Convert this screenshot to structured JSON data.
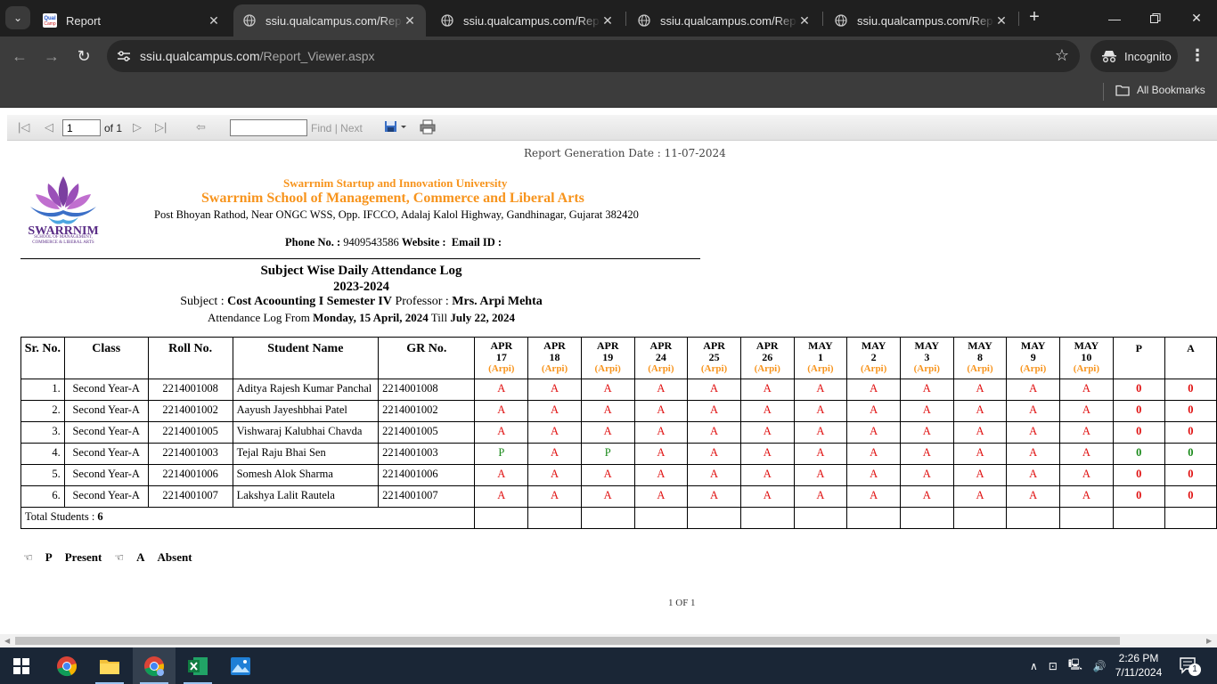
{
  "browser": {
    "tabs": [
      {
        "title": "Report",
        "active": false
      },
      {
        "title": "ssiu.qualcampus.com/Report_Viewer.aspx",
        "active": true
      },
      {
        "title": "ssiu.qualcampus.com/Report_Viewer.aspx",
        "active": false
      },
      {
        "title": "ssiu.qualcampus.com/Report_Viewer.aspx",
        "active": false
      },
      {
        "title": "ssiu.qualcampus.com/Report_Viewer.aspx",
        "active": false
      }
    ],
    "url_host": "ssiu.qualcampus.com",
    "url_path": "/Report_Viewer.aspx",
    "incognito_label": "Incognito",
    "bookmarks_label": "All Bookmarks"
  },
  "viewer": {
    "page_value": "1",
    "of_label": "of 1",
    "find_label": "Find",
    "separator": "|",
    "next_label": "Next"
  },
  "report": {
    "generation_date": "Report Generation Date : 11-07-2024",
    "logo_text": "SWARRNIM",
    "logo_subtext": "SCHOOL OF MANAGEMENT, COMMERCE & LIBERAL ARTS",
    "university": "Swarrnim Startup and Innovation University",
    "school": "Swarrnim School of Management, Commerce and Liberal Arts",
    "address": "Post Bhoyan Rathod, Near ONGC WSS, Opp. IFCCO, Adalaj Kalol Highway, Gandhinagar, Gujarat 382420",
    "phone_label": "Phone No. :",
    "phone": "9409543586",
    "website_label": "Website :",
    "email_label": "Email ID :",
    "title": "Subject Wise Daily Attendance Log",
    "year": "2023-2024",
    "subject_label": "Subject :",
    "subject": "Cost Acoounting I Semester IV",
    "professor_label": "Professor :",
    "professor": "Mrs. Arpi Mehta",
    "log_from_label": "Attendance Log From",
    "log_from": "Monday, 15 April, 2024",
    "till_label": "Till",
    "log_till": "July 22, 2024",
    "headers": [
      "Sr. No.",
      "Class",
      "Roll No.",
      "Student Name",
      "GR No."
    ],
    "dates": [
      {
        "m": "APR",
        "d": "17",
        "p": "(Arpi)"
      },
      {
        "m": "APR",
        "d": "18",
        "p": "(Arpi)"
      },
      {
        "m": "APR",
        "d": "19",
        "p": "(Arpi)"
      },
      {
        "m": "APR",
        "d": "24",
        "p": "(Arpi)"
      },
      {
        "m": "APR",
        "d": "25",
        "p": "(Arpi)"
      },
      {
        "m": "APR",
        "d": "26",
        "p": "(Arpi)"
      },
      {
        "m": "MAY",
        "d": "1",
        "p": "(Arpi)"
      },
      {
        "m": "MAY",
        "d": "2",
        "p": "(Arpi)"
      },
      {
        "m": "MAY",
        "d": "3",
        "p": "(Arpi)"
      },
      {
        "m": "MAY",
        "d": "8",
        "p": "(Arpi)"
      },
      {
        "m": "MAY",
        "d": "9",
        "p": "(Arpi)"
      },
      {
        "m": "MAY",
        "d": "10",
        "p": "(Arpi)"
      }
    ],
    "p_header": "P",
    "a_header": "A",
    "rows": [
      {
        "sr": "1.",
        "cls": "Second Year-A",
        "roll": "2214001008",
        "name": "Aditya Rajesh Kumar Panchal",
        "gr": "2214001008",
        "marks": [
          "A",
          "A",
          "A",
          "A",
          "A",
          "A",
          "A",
          "A",
          "A",
          "A",
          "A",
          "A"
        ],
        "p": "0",
        "a": "0"
      },
      {
        "sr": "2.",
        "cls": "Second Year-A",
        "roll": "2214001002",
        "name": "Aayush Jayeshbhai Patel",
        "gr": "2214001002",
        "marks": [
          "A",
          "A",
          "A",
          "A",
          "A",
          "A",
          "A",
          "A",
          "A",
          "A",
          "A",
          "A"
        ],
        "p": "0",
        "a": "0"
      },
      {
        "sr": "3.",
        "cls": "Second Year-A",
        "roll": "2214001005",
        "name": "Vishwaraj Kalubhai Chavda",
        "gr": "2214001005",
        "marks": [
          "A",
          "A",
          "A",
          "A",
          "A",
          "A",
          "A",
          "A",
          "A",
          "A",
          "A",
          "A"
        ],
        "p": "0",
        "a": "0"
      },
      {
        "sr": "4.",
        "cls": "Second Year-A",
        "roll": "2214001003",
        "name": "Tejal Raju Bhai Sen",
        "gr": "2214001003",
        "marks": [
          "P",
          "A",
          "P",
          "A",
          "A",
          "A",
          "A",
          "A",
          "A",
          "A",
          "A",
          "A"
        ],
        "p": "0",
        "a": "0"
      },
      {
        "sr": "5.",
        "cls": "Second Year-A",
        "roll": "2214001006",
        "name": "Somesh Alok Sharma",
        "gr": "2214001006",
        "marks": [
          "A",
          "A",
          "A",
          "A",
          "A",
          "A",
          "A",
          "A",
          "A",
          "A",
          "A",
          "A"
        ],
        "p": "0",
        "a": "0"
      },
      {
        "sr": "6.",
        "cls": "Second Year-A",
        "roll": "2214001007",
        "name": "Lakshya Lalit Rautela",
        "gr": "2214001007",
        "marks": [
          "A",
          "A",
          "A",
          "A",
          "A",
          "A",
          "A",
          "A",
          "A",
          "A",
          "A",
          "A"
        ],
        "p": "0",
        "a": "0"
      }
    ],
    "total_label": "Total Students :",
    "total": "6",
    "legend": [
      {
        "key": "P",
        "label": "Present"
      },
      {
        "key": "A",
        "label": "Absent"
      }
    ],
    "page_footer": "1 OF 1"
  },
  "taskbar": {
    "apps": [
      "windows-start",
      "chrome",
      "file-explorer",
      "chrome-profile",
      "excel",
      "photos"
    ],
    "time": "2:26 PM",
    "date": "7/11/2024",
    "notification_count": "1"
  },
  "colors": {
    "accent_orange": "#f7941d",
    "absent_red": "#e01010",
    "present_green": "#1a8a1a"
  }
}
